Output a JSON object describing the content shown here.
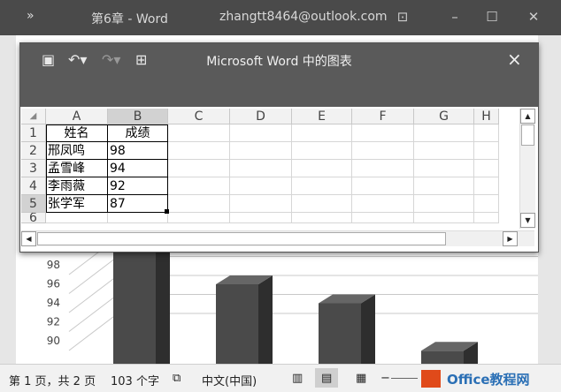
{
  "word": {
    "qat_icon": "»",
    "title": "第6章 - Word",
    "account": "zhangtt8464@outlook.com",
    "window_buttons": [
      "restore-ribbon-icon",
      "minimize-icon",
      "maximize-icon",
      "close-icon"
    ]
  },
  "dialog": {
    "title": "Microsoft Word 中的图表",
    "close": "×",
    "toolbar_icons": [
      "save-icon",
      "undo-icon",
      "redo-icon",
      "edit-data-in-excel-icon"
    ]
  },
  "sheet": {
    "columns": [
      "A",
      "B",
      "C",
      "D",
      "E",
      "F",
      "G",
      "H"
    ],
    "row_numbers": [
      "1",
      "2",
      "3",
      "4",
      "5",
      "6"
    ],
    "selected_column": "B",
    "selected_row": "5",
    "rows": [
      [
        "姓名",
        "成绩"
      ],
      [
        "邢凤鸣",
        "98"
      ],
      [
        "孟雪峰",
        "94"
      ],
      [
        "李雨薇",
        "92"
      ],
      [
        "张学军",
        "87"
      ]
    ]
  },
  "chart_data": {
    "type": "bar",
    "title": "",
    "categories": [
      "邢凤鸣",
      "孟雪峰",
      "李雨薇",
      "张学军"
    ],
    "values": [
      98,
      94,
      92,
      87
    ],
    "y_ticks": [
      "90",
      "92",
      "94",
      "96",
      "98"
    ],
    "ylim": [
      90,
      100
    ],
    "bar_color": "#4a4a4a"
  },
  "status": {
    "page": "第 1 页，共 2 页",
    "words": "103 个字",
    "language": "中文(中国)",
    "watermark": "Office教程网",
    "zoom": "−"
  }
}
